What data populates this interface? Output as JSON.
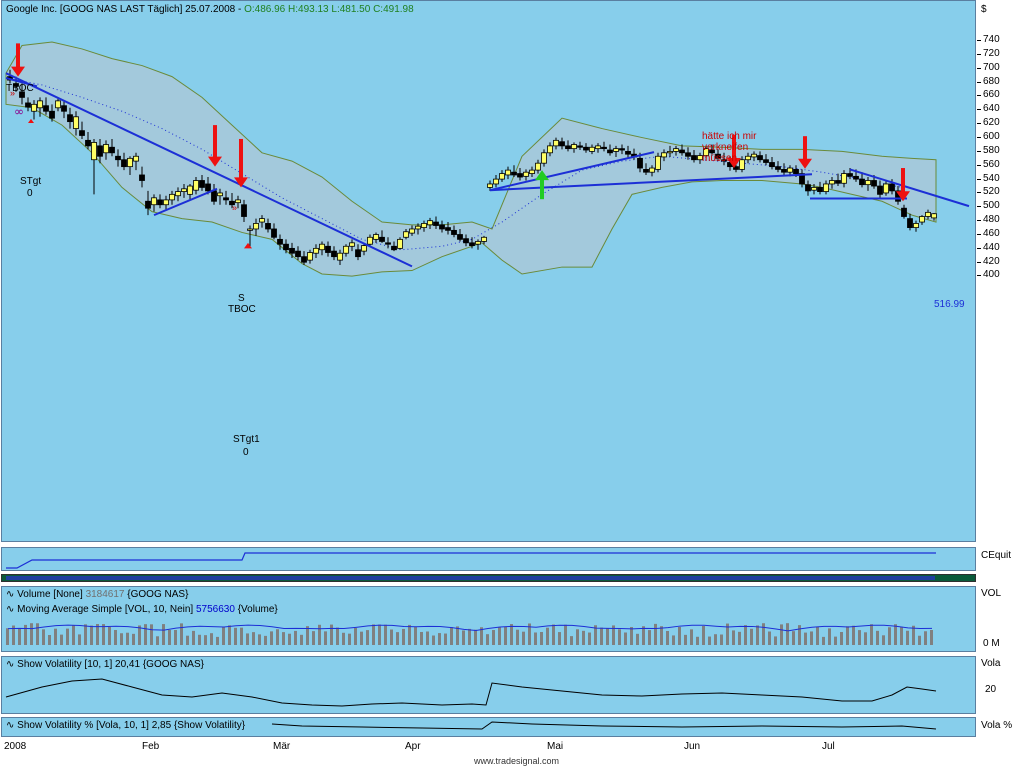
{
  "main": {
    "title_prefix": "Google Inc. [GOOG NAS LAST Täglich] 25.07.2008 - ",
    "ohlc": "O:486.96 H:493.13 L:481.50 C:491.98",
    "currency": "$",
    "y_ticks": [
      "740",
      "720",
      "700",
      "680",
      "660",
      "640",
      "620",
      "600",
      "580",
      "560",
      "540",
      "520",
      "500",
      "480",
      "460",
      "440",
      "420",
      "400"
    ],
    "last_value_label": "516.99",
    "annotation_comment": [
      "hätte ich mir",
      "verkneifen",
      "müssen"
    ],
    "marker_tboc_1": "TBOC",
    "marker_stgt_1": "STgt",
    "marker_stgt_1_val": "0",
    "marker_s_2": "S",
    "marker_tboc_2": "TBOC",
    "marker_stgt1": "STgt1",
    "marker_stgt1_val": "0",
    "colors": {
      "bg": "#87ceeb",
      "band": "#a3c9dc",
      "trend": "#1c2fd6",
      "arrow_red": "#ee1111",
      "arrow_green": "#22cc22",
      "candle_up": "#ffff66",
      "candle_down": "#000000"
    }
  },
  "equity": {
    "label": "CEquit"
  },
  "volume": {
    "title1": "Volume [None]",
    "value1": "3184617",
    "source1": "{GOOG NAS}",
    "title2": "Moving Average Simple [VOL, 10, Nein]",
    "value2": "5756630",
    "source2": "{Volume}",
    "axis_label": "VOL",
    "tick_label": "0 M"
  },
  "volatility": {
    "title": "Show Volatility [10, 1]",
    "value": "20,41",
    "source": "{GOOG NAS}",
    "axis_label": "Vola",
    "tick_label": "20"
  },
  "volatility_pct": {
    "title": "Show Volatility % [Vola, 10, 1]",
    "value": "2,85",
    "source": "{Show Volatility}",
    "axis_label": "Vola %"
  },
  "x_axis": {
    "labels": [
      "2008",
      "Feb",
      "Mär",
      "Apr",
      "Mai",
      "Jun",
      "Jul"
    ]
  },
  "footer": "www.tradesignal.com"
}
